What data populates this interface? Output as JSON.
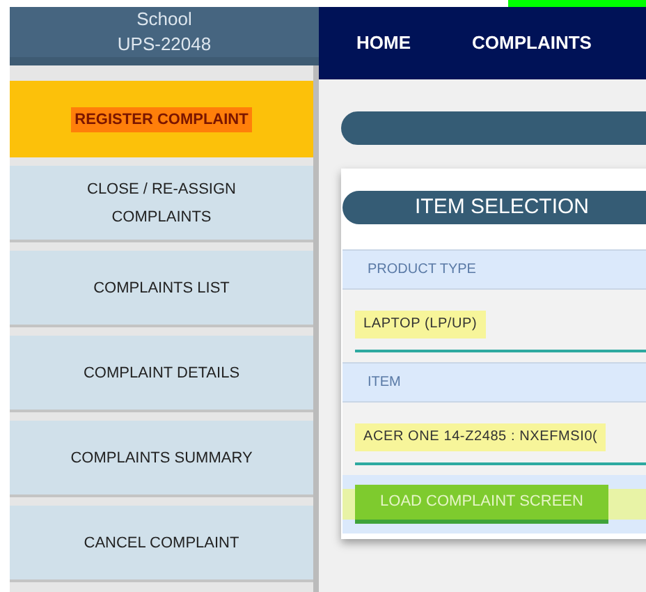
{
  "sidebar": {
    "header": {
      "line1": "School",
      "line2": "UPS-22048"
    },
    "items": [
      {
        "label": "REGISTER COMPLAINT",
        "selected": true
      },
      {
        "label": "CLOSE / RE-ASSIGN COMPLAINTS",
        "selected": false
      },
      {
        "label": "COMPLAINTS LIST",
        "selected": false
      },
      {
        "label": "COMPLAINT DETAILS",
        "selected": false
      },
      {
        "label": "COMPLAINTS SUMMARY",
        "selected": false
      },
      {
        "label": "CANCEL COMPLAINT",
        "selected": false
      }
    ]
  },
  "nav": {
    "items": [
      "HOME",
      "COMPLAINTS"
    ]
  },
  "card": {
    "title": "ITEM SELECTION",
    "fields": [
      {
        "label": "PRODUCT TYPE",
        "value": "LAPTOP (LP/UP)"
      },
      {
        "label": "ITEM",
        "value": "ACER ONE 14-Z2485 : NXEFMSI0("
      }
    ],
    "button": "LOAD COMPLAINT SCREEN"
  }
}
